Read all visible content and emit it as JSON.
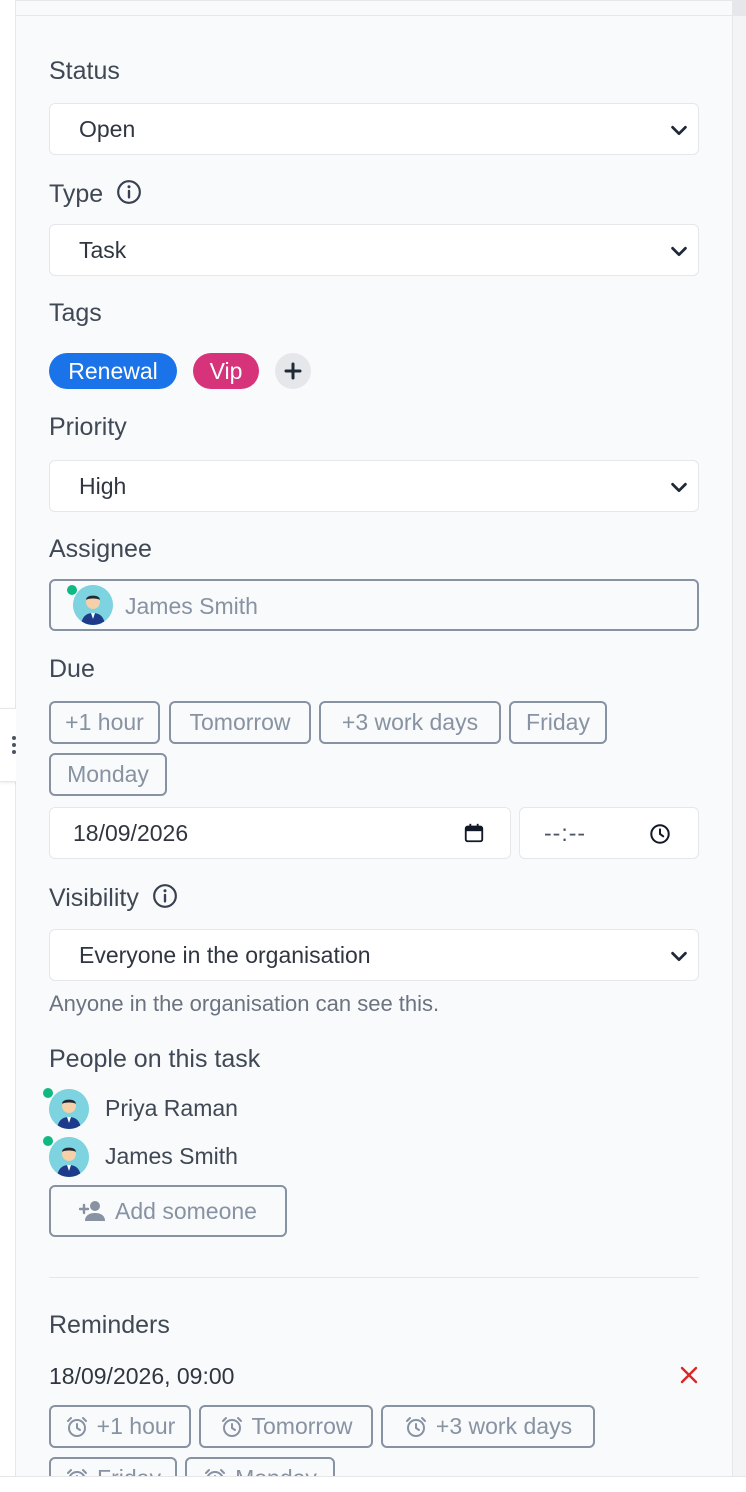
{
  "status": {
    "label": "Status",
    "value": "Open"
  },
  "type": {
    "label": "Type",
    "value": "Task"
  },
  "tags": {
    "label": "Tags",
    "items": [
      {
        "label": "Renewal",
        "color": "#1a73e8"
      },
      {
        "label": "Vip",
        "color": "#d6337a"
      }
    ]
  },
  "priority": {
    "label": "Priority",
    "value": "High"
  },
  "assignee": {
    "label": "Assignee",
    "name": "James Smith"
  },
  "due": {
    "label": "Due",
    "quick_options": [
      "+1 hour",
      "Tomorrow",
      "+3 work days",
      "Friday",
      "Monday"
    ],
    "date": "18/09/2026",
    "time_placeholder": "--:--"
  },
  "visibility": {
    "label": "Visibility",
    "value": "Everyone in the organisation",
    "hint": "Anyone in the organisation can see this."
  },
  "people": {
    "label": "People on this task",
    "members": [
      "Priya Raman",
      "James Smith"
    ],
    "add_label": "Add someone"
  },
  "reminders": {
    "label": "Reminders",
    "entry": "18/09/2026, 09:00",
    "quick_options": [
      "+1 hour",
      "Tomorrow",
      "+3 work days",
      "Friday",
      "Monday"
    ]
  },
  "icons": {
    "chevron": "chevron-down-icon",
    "info": "info-icon",
    "calendar": "calendar-icon",
    "clock": "clock-icon",
    "alarm": "alarm-icon",
    "add_person": "add-person-icon",
    "remove": "close-icon",
    "more": "more-vertical-icon"
  },
  "colors": {
    "online": "#10b981",
    "remove": "#dc2626",
    "chip_border": "#8792a2"
  }
}
